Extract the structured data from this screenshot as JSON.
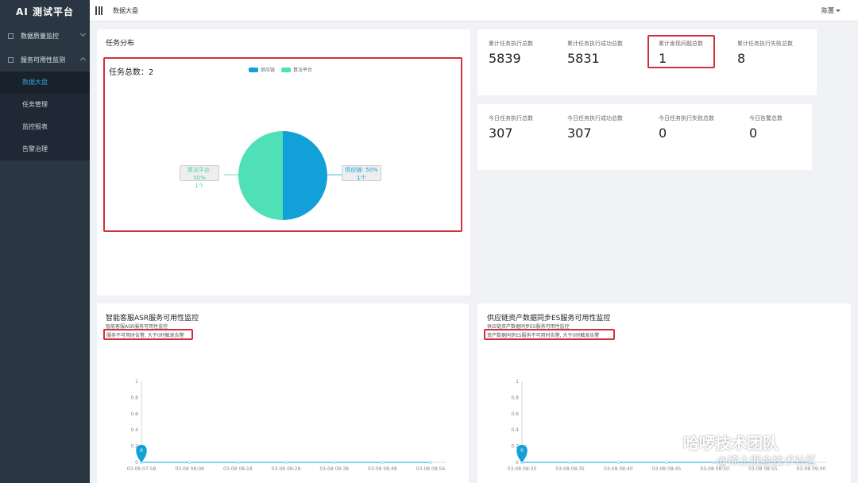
{
  "brand": "AI 测试平台",
  "sidebar": {
    "groups": [
      {
        "label": "数据质量监控"
      },
      {
        "label": "服务可用性监测"
      }
    ],
    "subitems": [
      {
        "label": "数据大盘"
      },
      {
        "label": "任务管理"
      },
      {
        "label": "监控报表"
      },
      {
        "label": "告警治理"
      }
    ]
  },
  "header": {
    "breadcrumb": "数据大盘",
    "user": "陈蕙"
  },
  "task_panel": {
    "title": "任务分布",
    "total_label": "任务总数：2",
    "legend": [
      {
        "name": "供应链",
        "color": "#11a0d8"
      },
      {
        "name": "算法平台",
        "color": "#4fe0b7"
      }
    ],
    "label_left": {
      "line1": "算法平台: 50%",
      "line2": "1个"
    },
    "label_right": {
      "line1": "供应链: 50%",
      "line2": "1个"
    }
  },
  "cumulative": [
    {
      "label": "累计任务执行总数",
      "value": "5839"
    },
    {
      "label": "累计任务执行成功总数",
      "value": "5831"
    },
    {
      "label": "累计发现问题总数",
      "value": "1"
    },
    {
      "label": "累计任务执行失败总数",
      "value": "8"
    }
  ],
  "today": [
    {
      "label": "今日任务执行总数",
      "value": "307"
    },
    {
      "label": "今日任务执行成功总数",
      "value": "307"
    },
    {
      "label": "今日任务执行失败总数",
      "value": "0"
    },
    {
      "label": "今日告警总数",
      "value": "0"
    }
  ],
  "asr": {
    "title": "智能客服ASR服务可用性监控",
    "sub1": "智能客服ASR服务可用性监控",
    "sub2": "服务不可用时告警, 大于0时触发告警"
  },
  "es": {
    "title": "供应链资产数据同步ES服务可用性监控",
    "sub1": "供应链资产数据同步ES服务可用性监控",
    "sub2": "资产数据同步ES服务不可用时告警, 大于0时触发告警"
  },
  "watermark": {
    "line1": "哈啰技术团队",
    "line2": "@稀土掘金技术社区"
  },
  "chart_data": [
    {
      "type": "pie",
      "categories": [
        "供应链",
        "算法平台"
      ],
      "values": [
        1,
        1
      ]
    },
    {
      "type": "line",
      "x": [
        "03-08 07:58",
        "03-08 08:08",
        "03-08 08:18",
        "03-08 08:28",
        "03-08 08:38",
        "03-08 08:48",
        "03-08 08:56"
      ],
      "values": [
        0,
        0,
        0,
        0,
        0,
        0,
        0
      ],
      "yticks": [
        "0",
        "0.2",
        "0.4",
        "0.6",
        "0.8",
        "1"
      ],
      "ylim": [
        0,
        1
      ],
      "marker_label": "0"
    },
    {
      "type": "line",
      "x": [
        "03-08 08:30",
        "03-08 08:35",
        "03-08 08:40",
        "03-08 08:45",
        "03-08 08:50",
        "03-08 08:55",
        "03-08 09:00"
      ],
      "values": [
        0,
        0,
        0,
        0,
        0,
        0,
        0
      ],
      "yticks": [
        "0",
        "0.2",
        "0.4",
        "0.6",
        "0.8",
        "1"
      ],
      "ylim": [
        0,
        1
      ],
      "marker_label": "0"
    }
  ]
}
